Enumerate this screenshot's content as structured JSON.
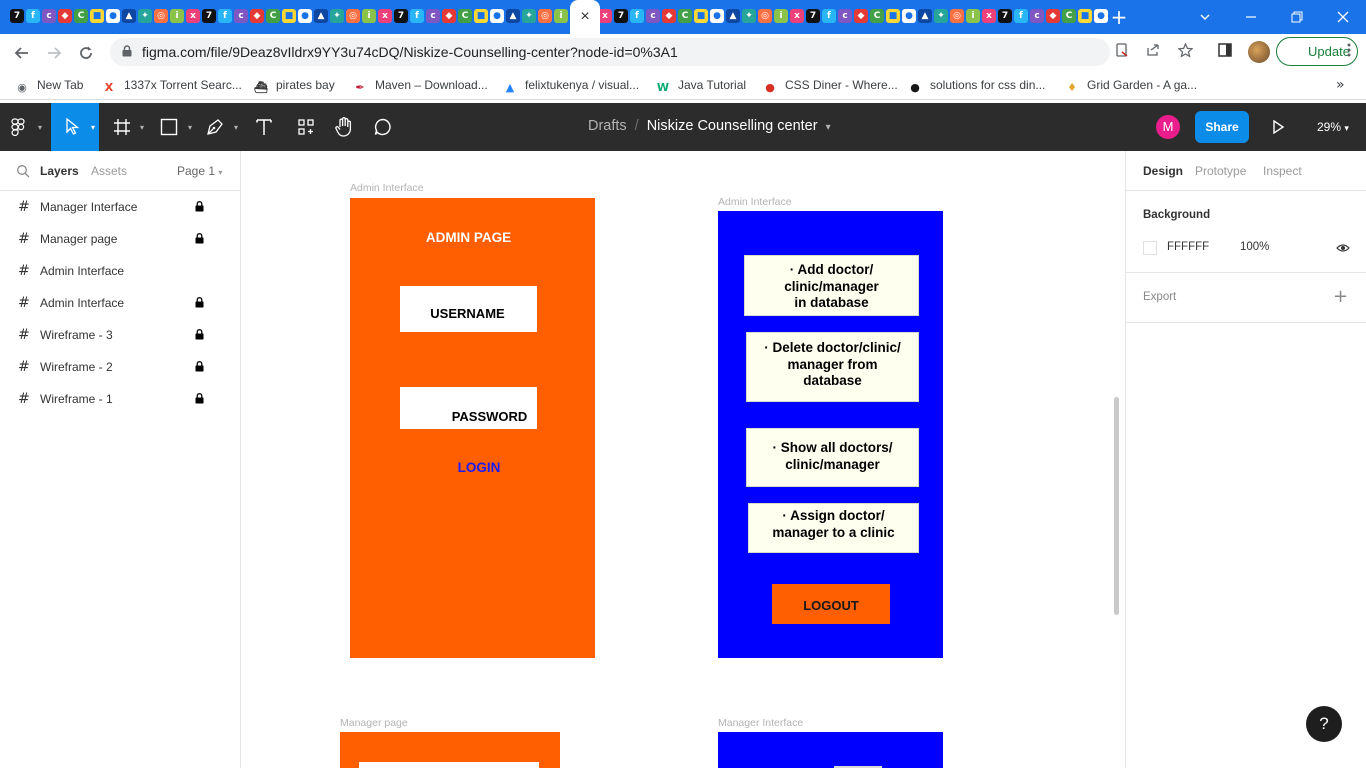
{
  "browser": {
    "url": "figma.com/file/9Deaz8vIldrx9YY3u74cDQ/Niskize-Counselling-center?node-id=0%3A1",
    "update_label": "Update",
    "new_tab_icon": "+",
    "close_tab_icon": "×",
    "bookmarks": [
      {
        "label": "New Tab",
        "icon": "globe-icon",
        "color": "#5f6368"
      },
      {
        "label": "1337x Torrent Searc...",
        "icon": "x-icon",
        "color": "#e8442d"
      },
      {
        "label": "pirates bay",
        "icon": "ship-icon",
        "color": "#333333"
      },
      {
        "label": "Maven – Download...",
        "icon": "feather-icon",
        "color": "#c71a36"
      },
      {
        "label": "felixtukenya / visual...",
        "icon": "atlassian-icon",
        "color": "#2684ff"
      },
      {
        "label": "Java Tutorial",
        "icon": "w3-icon",
        "color": "#04aa6d"
      },
      {
        "label": "CSS Diner - Where...",
        "icon": "plate-icon",
        "color": "#d93025"
      },
      {
        "label": "solutions for css din...",
        "icon": "github-icon",
        "color": "#181717"
      },
      {
        "label": "Grid Garden - A ga...",
        "icon": "carrot-icon",
        "color": "#e0a82e"
      }
    ]
  },
  "toolbar": {
    "breadcrumb_parent": "Drafts",
    "separator": "/",
    "file_name": "Niskize Counselling center",
    "user_initial": "M",
    "share_label": "Share",
    "zoom": "29%"
  },
  "left_panel": {
    "tabs": {
      "layers": "Layers",
      "assets": "Assets",
      "page": "Page 1"
    },
    "layers": [
      {
        "name": "Manager Interface",
        "locked": true
      },
      {
        "name": "Manager page",
        "locked": true
      },
      {
        "name": "Admin Interface",
        "locked": false
      },
      {
        "name": "Admin Interface",
        "locked": true
      },
      {
        "name": "Wireframe - 3",
        "locked": true
      },
      {
        "name": "Wireframe - 2",
        "locked": true
      },
      {
        "name": "Wireframe - 1",
        "locked": true
      }
    ]
  },
  "canvas": {
    "frame_admin_login": {
      "label": "Admin Interface",
      "color": "#ff5f00",
      "title": "ADMIN PAGE",
      "username": "USERNAME",
      "password": "PASSWORD",
      "login": "LOGIN"
    },
    "frame_admin_menu": {
      "label": "Admin Interface",
      "color": "#0000ff",
      "items": [
        [
          "· Add doctor/",
          "clinic/manager",
          "in database"
        ],
        [
          "· Delete doctor/clinic/",
          "manager from",
          "database"
        ],
        [
          "· Show all doctors/",
          "clinic/manager"
        ],
        [
          "· Assign doctor/",
          "manager to a clinic"
        ]
      ],
      "logout": "LOGOUT"
    },
    "frame_manager_page": {
      "label": "Manager page",
      "color": "#ff5f00"
    },
    "frame_manager_interface": {
      "label": "Manager Interface",
      "color": "#0000ff"
    }
  },
  "right_panel": {
    "tabs": {
      "design": "Design",
      "prototype": "Prototype",
      "inspect": "Inspect"
    },
    "background_title": "Background",
    "background_hex": "FFFFFF",
    "background_opacity": "100%",
    "export_title": "Export",
    "export_add": "+"
  },
  "help_label": "?"
}
